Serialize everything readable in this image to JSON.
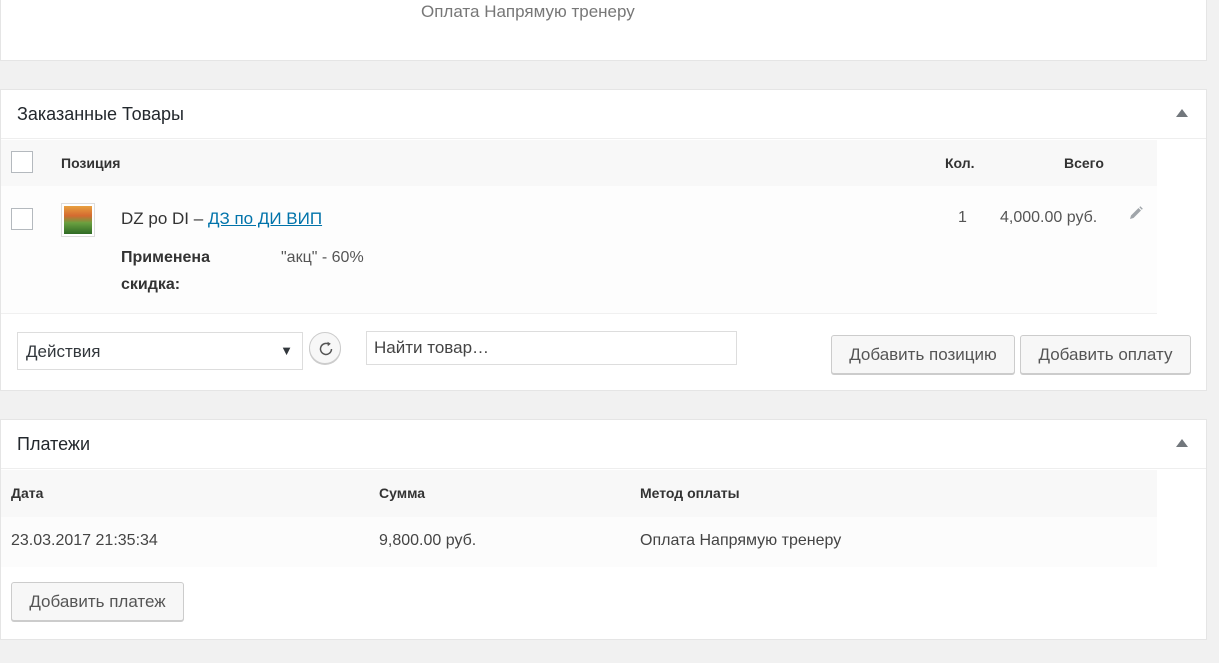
{
  "top_section": {
    "payment_method_text": "Оплата Напрямую тренеру"
  },
  "order_items": {
    "title": "Заказанные Товары",
    "columns": {
      "position": "Позиция",
      "qty": "Кол.",
      "total": "Всего"
    },
    "items": [
      {
        "name_prefix": "DZ po DI –",
        "name_link": "ДЗ по ДИ ВИП",
        "qty": "1",
        "total": "4,000.00 руб.",
        "meta_key": "Применена скидка:",
        "meta_value": "\"акц\" - 60%"
      }
    ],
    "actions_select": "Действия",
    "search_placeholder": "Найти товар…",
    "add_position_label": "Добавить позицию",
    "add_fee_label": "Добавить оплату"
  },
  "payments": {
    "title": "Платежи",
    "columns": {
      "date": "Дата",
      "amount": "Сумма",
      "method": "Метод оплаты"
    },
    "rows": [
      {
        "date": "23.03.2017 21:35:34",
        "amount": "9,800.00 руб.",
        "method": "Оплата Напрямую тренеру"
      }
    ],
    "add_payment_label": "Добавить платеж"
  },
  "icons": {
    "toggle": "triangle-up-icon",
    "edit": "pencil-icon",
    "refresh": "refresh-icon",
    "dropdown": "chevron-down-icon"
  }
}
